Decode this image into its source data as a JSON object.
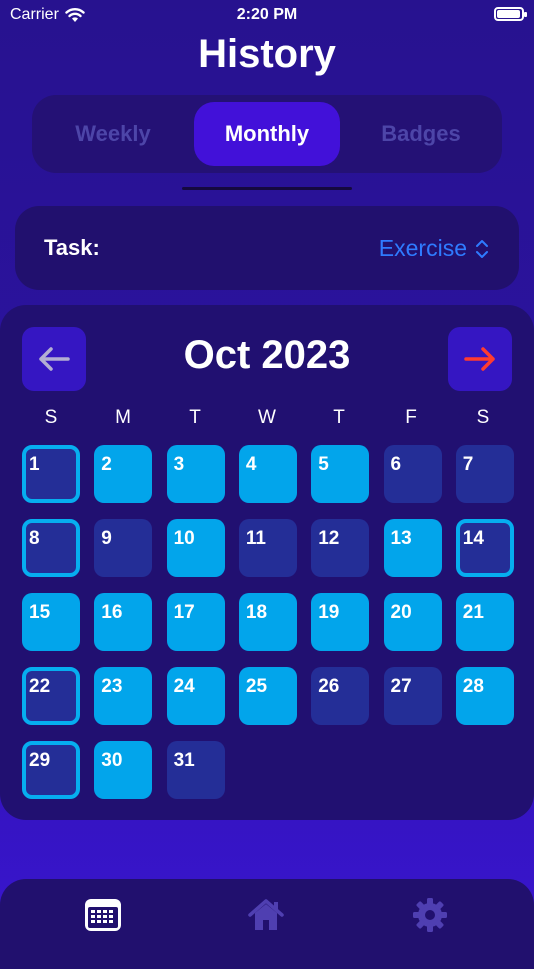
{
  "status_bar": {
    "carrier": "Carrier",
    "time": "2:20 PM",
    "battery_level": 0.95
  },
  "header": {
    "title": "History"
  },
  "segments": [
    {
      "label": "Weekly",
      "selected": false
    },
    {
      "label": "Monthly",
      "selected": true
    },
    {
      "label": "Badges",
      "selected": false
    }
  ],
  "task": {
    "label": "Task:",
    "value": "Exercise"
  },
  "calendar": {
    "month_label": "Oct 2023",
    "weekday_labels": [
      "S",
      "M",
      "T",
      "W",
      "T",
      "F",
      "S"
    ],
    "days": [
      {
        "num": "1",
        "status": "highlighted"
      },
      {
        "num": "2",
        "status": "completed"
      },
      {
        "num": "3",
        "status": "completed"
      },
      {
        "num": "4",
        "status": "completed"
      },
      {
        "num": "5",
        "status": "completed"
      },
      {
        "num": "6",
        "status": "missed"
      },
      {
        "num": "7",
        "status": "missed"
      },
      {
        "num": "8",
        "status": "highlighted"
      },
      {
        "num": "9",
        "status": "missed"
      },
      {
        "num": "10",
        "status": "completed"
      },
      {
        "num": "11",
        "status": "missed"
      },
      {
        "num": "12",
        "status": "missed"
      },
      {
        "num": "13",
        "status": "completed"
      },
      {
        "num": "14",
        "status": "highlighted"
      },
      {
        "num": "15",
        "status": "completed"
      },
      {
        "num": "16",
        "status": "completed"
      },
      {
        "num": "17",
        "status": "completed"
      },
      {
        "num": "18",
        "status": "completed"
      },
      {
        "num": "19",
        "status": "completed"
      },
      {
        "num": "20",
        "status": "completed"
      },
      {
        "num": "21",
        "status": "completed"
      },
      {
        "num": "22",
        "status": "highlighted"
      },
      {
        "num": "23",
        "status": "completed"
      },
      {
        "num": "24",
        "status": "completed"
      },
      {
        "num": "25",
        "status": "completed"
      },
      {
        "num": "26",
        "status": "missed"
      },
      {
        "num": "27",
        "status": "missed"
      },
      {
        "num": "28",
        "status": "completed"
      },
      {
        "num": "29",
        "status": "highlighted"
      },
      {
        "num": "30",
        "status": "completed"
      },
      {
        "num": "31",
        "status": "missed"
      }
    ]
  },
  "icons": {
    "prev": "arrow-left-icon",
    "next": "arrow-right-icon",
    "tab_history": "calendar-icon",
    "tab_home": "house-icon",
    "tab_settings": "gear-icon"
  },
  "colors": {
    "accent": "#4211d9",
    "completed": "#02a5eb",
    "missed": "#242e97",
    "highlight_border": "#06aef0",
    "next_arrow": "#ff3b30",
    "task_value": "#2f7bff"
  }
}
